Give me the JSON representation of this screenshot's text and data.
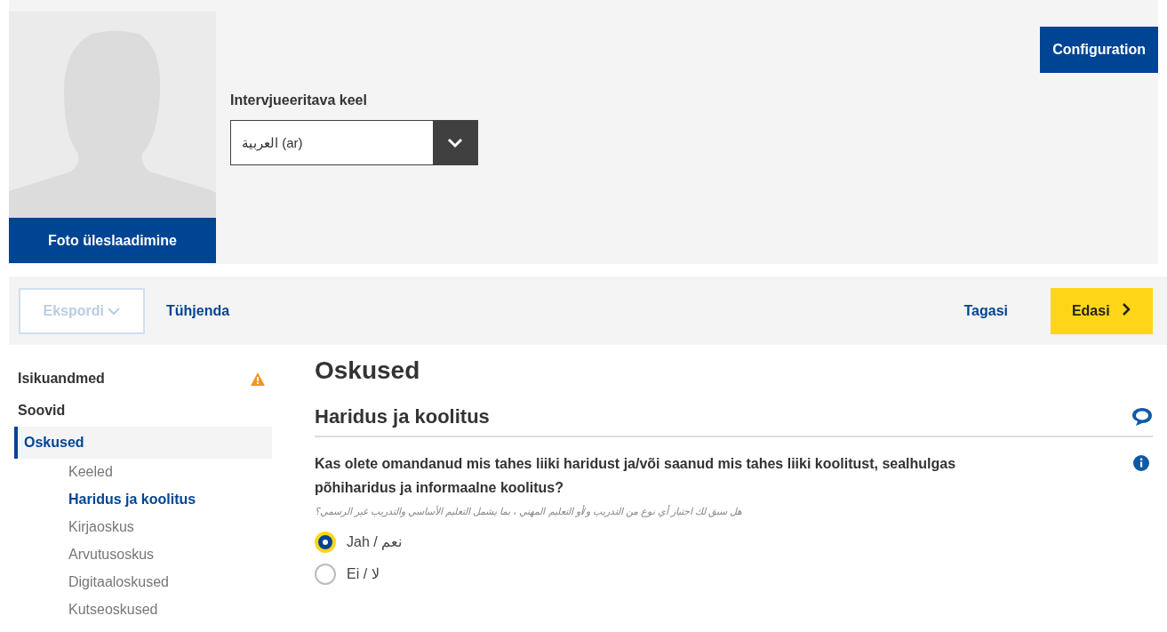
{
  "profile": {
    "upload_button": "Foto üleslaadimine",
    "language_label": "Intervjueeritava keel",
    "language_value": "العربية (ar)",
    "config_button": "Configuration"
  },
  "toolbar": {
    "export": {
      "label": "Ekspordi",
      "disabled": true
    },
    "clear": "Tühjenda",
    "back": "Tagasi",
    "next": "Edasi"
  },
  "sidebar": [
    {
      "label": "Isikuandmed",
      "selected": false,
      "warning": true
    },
    {
      "label": "Soovid",
      "selected": false,
      "warning": false
    },
    {
      "label": "Oskused",
      "selected": true,
      "warning": false,
      "children": [
        {
          "label": "Keeled",
          "selected": false
        },
        {
          "label": "Haridus ja koolitus",
          "selected": true
        },
        {
          "label": "Kirjaoskus",
          "selected": false
        },
        {
          "label": "Arvutusoskus",
          "selected": false
        },
        {
          "label": "Digitaaloskused",
          "selected": false
        },
        {
          "label": "Kutseoskused",
          "selected": false
        }
      ]
    }
  ],
  "page_title": "Oskused",
  "section_title": "Haridus ja koolitus",
  "question": "Kas olete omandanud mis tahes liiki haridust ja/või saanud mis tahes liiki koolitust, sealhulgas põhiharidus ja informaalne koolitus?",
  "question_translation": "هل سبق لك اجتياز أي نوع من التدريب و/أو التعليم المهني ، بما يشمل التعليم الأساسي والتدريب غير الرسمي؟",
  "options": [
    {
      "label": "Jah / نعم",
      "selected": true
    },
    {
      "label": "Ei / لا",
      "selected": false
    }
  ]
}
